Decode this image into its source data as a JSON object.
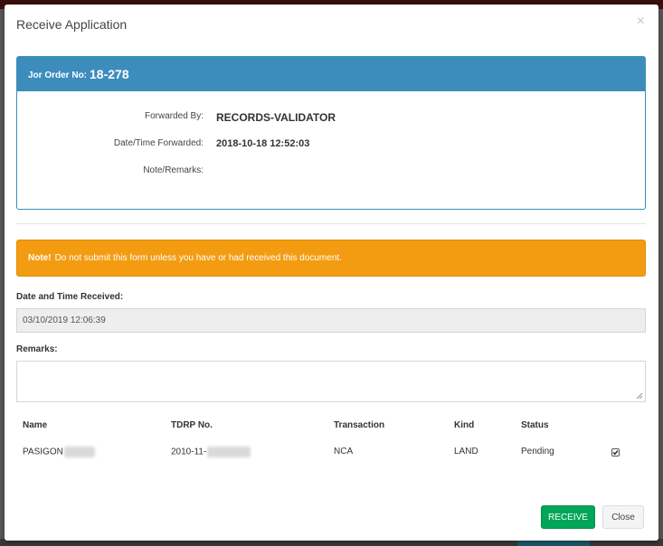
{
  "modal": {
    "title": "Receive Application",
    "close_glyph": "×"
  },
  "panel": {
    "job_order_label": "Jor Order No:",
    "job_order_number": "18-278",
    "rows": [
      {
        "label": "Forwarded By:",
        "value": "RECORDS-VALIDATOR"
      },
      {
        "label": "Date/Time Forwarded:",
        "value": "2018-10-18 12:52:03"
      },
      {
        "label": "Note/Remarks:",
        "value": ""
      }
    ]
  },
  "alert": {
    "strong": "Note!",
    "text": "Do not submit this form unless you have or had received this document.",
    "color": "#f39c12"
  },
  "form": {
    "date_received_label": "Date and Time Received:",
    "date_received_value": "03/10/2019 12:06:39",
    "remarks_label": "Remarks:",
    "remarks_value": ""
  },
  "table": {
    "headers": [
      "Name",
      "TDRP No.",
      "Transaction",
      "Kind",
      "Status"
    ],
    "rows": [
      {
        "name": "PASIGON",
        "tdrp": "2010-11-",
        "transaction": "NCA",
        "kind": "LAND",
        "status": "Pending",
        "checked": true
      }
    ]
  },
  "buttons": {
    "receive": "RECEIVE",
    "close": "Close"
  },
  "colors": {
    "primary": "#3c8dbc",
    "warning": "#f39c12",
    "success": "#00a65a"
  }
}
